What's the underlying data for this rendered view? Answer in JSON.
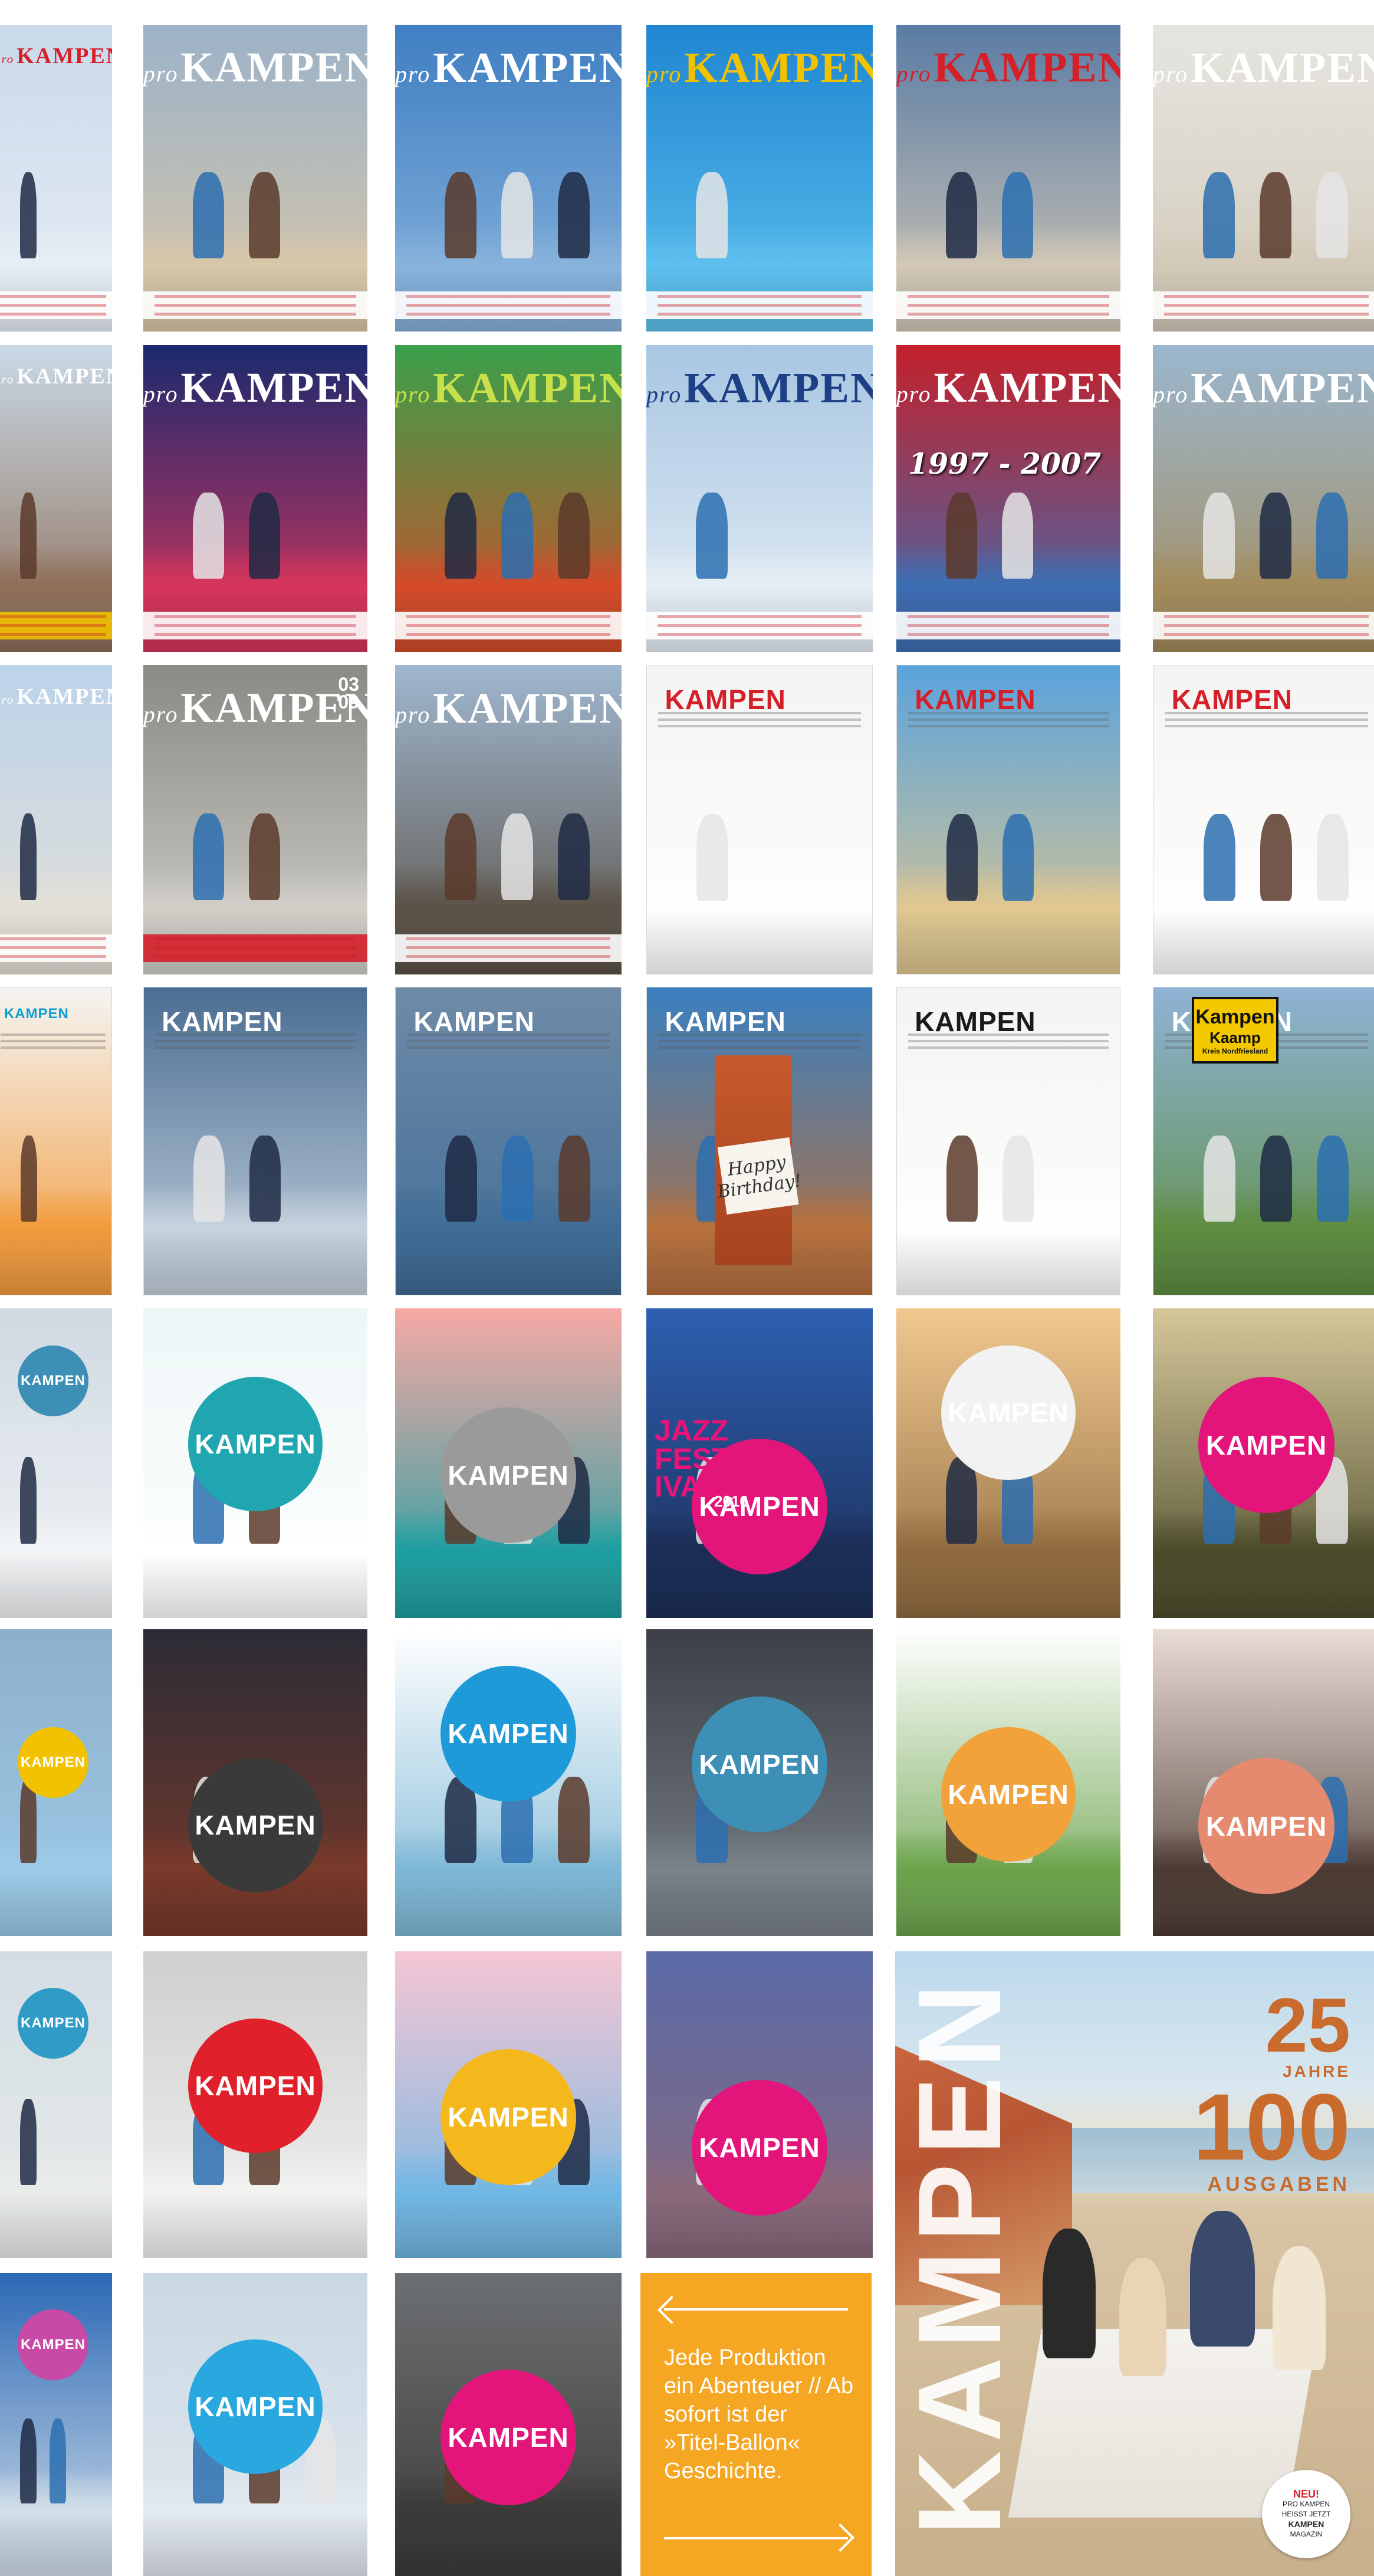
{
  "masthead": "KAMPEN",
  "prefix": "pro",
  "covers": [
    {
      "kind": "serif",
      "bg": [
        "#c9d9ea",
        "#e7eef5"
      ],
      "mast": "#d5202a",
      "band": "#ffffff"
    },
    {
      "kind": "serif",
      "bg": [
        "#9cb2c8",
        "#d8c7a8"
      ],
      "mast": "#ffffff",
      "band": "#ffffff"
    },
    {
      "kind": "serif",
      "bg": [
        "#3f7fc2",
        "#88b3dc"
      ],
      "mast": "#ffffff",
      "band": "#ffffff"
    },
    {
      "kind": "serif",
      "bg": [
        "#1f86d1",
        "#5ec0ee"
      ],
      "mast": "#f2c200",
      "band": "#ffffff"
    },
    {
      "kind": "serif",
      "bg": [
        "#5a7ca4",
        "#d3c8b6"
      ],
      "mast": "#d5202a",
      "band": "#ffffff"
    },
    {
      "kind": "serif",
      "bg": [
        "#e5e5e0",
        "#d3c9b8"
      ],
      "mast": "#ffffff",
      "band": "#ffffff"
    },
    {
      "kind": "serif",
      "bg": [
        "#c9d9e7",
        "#8e6f58"
      ],
      "mast": "#ffffff",
      "band": "#f0c000"
    },
    {
      "kind": "serif",
      "bg": [
        "#1b2a6e",
        "#d9355b"
      ],
      "mast": "#ffffff",
      "band": "#ffffff"
    },
    {
      "kind": "serif",
      "bg": [
        "#3aa04a",
        "#d54a2a"
      ],
      "mast": "#c8e04a",
      "band": "#ffffff"
    },
    {
      "kind": "serif",
      "bg": [
        "#a8c6e2",
        "#e6eef5"
      ],
      "mast": "#1d3f86",
      "band": "#ffffff"
    },
    {
      "kind": "serif",
      "bg": [
        "#c3202a",
        "#3b6fb5"
      ],
      "mast": "#ffffff",
      "band": "#ffffff"
    },
    {
      "kind": "serif",
      "bg": [
        "#9bb7cf",
        "#a48b5a"
      ],
      "mast": "#ffffff",
      "band": "#ffffff"
    },
    {
      "kind": "serif",
      "bg": [
        "#bcd3ea",
        "#e4e0d6"
      ],
      "mast": "#ffffff",
      "band": "#ffffff"
    },
    {
      "kind": "serif",
      "bg": [
        "#8a8a86",
        "#d1cfc8"
      ],
      "mast": "#ffffff",
      "band": "#d5202a"
    },
    {
      "kind": "serif",
      "bg": [
        "#9fb7cf",
        "#5b5146"
      ],
      "mast": "#ffffff",
      "band": "#ffffff"
    },
    {
      "kind": "sans",
      "bg": [
        "#f4f4f2",
        "#ffffff"
      ],
      "mast": "#d5202a",
      "band": "#ffffff"
    },
    {
      "kind": "sans",
      "bg": [
        "#5aa3dc",
        "#e2c88e"
      ],
      "mast": "#d5202a",
      "band": "#ffffff"
    },
    {
      "kind": "sans",
      "bg": [
        "#f4f4f2",
        "#ffffff"
      ],
      "mast": "#d5202a",
      "band": "#ffffff"
    },
    {
      "kind": "sans",
      "bg": [
        "#f4f4f2",
        "#f29a3a"
      ],
      "mast": "#0aa0d0",
      "band": "#ffffff"
    },
    {
      "kind": "sans",
      "bg": [
        "#4a6d92",
        "#c7d3df"
      ],
      "mast": "#ffffff",
      "band": "#ffffff"
    },
    {
      "kind": "sans",
      "bg": [
        "#6f8ba8",
        "#3f6c96"
      ],
      "mast": "#ffffff",
      "band": "#ffffff"
    },
    {
      "kind": "sans",
      "bg": [
        "#3a7fc0",
        "#b9703a"
      ],
      "mast": "#ffffff",
      "band": "#ffffff"
    },
    {
      "kind": "sans",
      "bg": [
        "#f4f4f2",
        "#ffffff"
      ],
      "mast": "#1a1a1a",
      "band": "#ffffff"
    },
    {
      "kind": "sans",
      "bg": [
        "#8fb3d6",
        "#5d8c3e"
      ],
      "mast": "#ffffff",
      "band": "#ffffff"
    },
    {
      "kind": "bubble",
      "bg": [
        "#cfd9e2",
        "#f2f4f6"
      ],
      "bubble": "#3d8fb5"
    },
    {
      "kind": "bubble",
      "bg": [
        "#eef6f7",
        "#ffffff"
      ],
      "bubble": "#20a6b0"
    },
    {
      "kind": "bubble",
      "bg": [
        "#f7a9a5",
        "#1b9fa2"
      ],
      "bubble": "#9a9a9a"
    },
    {
      "kind": "bubble",
      "bg": [
        "#2d5fb0",
        "#1c2d55"
      ],
      "bubble": "#e3157a"
    },
    {
      "kind": "bubble",
      "bg": [
        "#f0c890",
        "#8f6a3e"
      ],
      "bubble": "#f2f2f2"
    },
    {
      "kind": "bubble",
      "bg": [
        "#d5c79a",
        "#4a4a2a"
      ],
      "bubble": "#e3157a"
    },
    {
      "kind": "bubble",
      "bg": [
        "#8fb0cc",
        "#9ccbe8"
      ],
      "bubble": "#f2c200"
    },
    {
      "kind": "bubble",
      "bg": [
        "#2c2c36",
        "#7a3a2a"
      ],
      "bubble": "#3a3a3a"
    },
    {
      "kind": "bubble",
      "bg": [
        "#ffffff",
        "#7cb7d6"
      ],
      "bubble": "#1f9ad8"
    },
    {
      "kind": "bubble",
      "bg": [
        "#3c3f46",
        "#7b828a"
      ],
      "bubble": "#3d8fb5"
    },
    {
      "kind": "bubble",
      "bg": [
        "#ffffff",
        "#6aa34a"
      ],
      "bubble": "#f2a23a"
    },
    {
      "kind": "bubble",
      "bg": [
        "#e9dcd5",
        "#4b3a32"
      ],
      "bubble": "#e58a6e"
    },
    {
      "kind": "bubble",
      "bg": [
        "#d3dde5",
        "#e9ece9"
      ],
      "bubble": "#2f9bc6"
    },
    {
      "kind": "bubble",
      "bg": [
        "#cfcfcd",
        "#f2f2f0"
      ],
      "bubble": "#e0202a"
    },
    {
      "kind": "bubble",
      "bg": [
        "#f5c6d4",
        "#6fb7e4"
      ],
      "bubble": "#f5b81c"
    },
    {
      "kind": "bubble",
      "bg": [
        "#5b6aa8",
        "#8a6a7a"
      ],
      "bubble": "#e3157a"
    },
    {
      "kind": "bubble",
      "bg": [
        "#2b68b5",
        "#d4e0ea"
      ],
      "bubble": "#c64aa6"
    },
    {
      "kind": "bubble",
      "bg": [
        "#c9d8e4",
        "#e2e9ef"
      ],
      "bubble": "#29a8e0"
    },
    {
      "kind": "bubble",
      "bg": [
        "#6c6f72",
        "#3c3a38"
      ],
      "bubble": "#e3157a"
    }
  ],
  "special": {
    "cover_2_years": "1997 - 2007",
    "cover_jazz": "JAZZ FEST IVAL",
    "cover_jazz_year": "2016",
    "cover_birthday": "Happy Birthday!",
    "cover_sign_line1": "Kampen",
    "cover_sign_line2": "Kaamp",
    "cover_sign_line3": "Kreis Nordfriesland",
    "issue_a": "03",
    "issue_b": "09"
  },
  "info": {
    "text": "Jede Produktion ein Abenteuer // Ab sofort ist der »Titel-Ballon« Geschichte.",
    "bg": "#f5a623"
  },
  "feature": {
    "title": "KAMPEN",
    "n25": "25",
    "jahre": "JAHRE",
    "n100": "100",
    "ausgaben": "AUSGABEN",
    "badge_neu": "NEU!",
    "badge_l1": "PRO KAMPEN",
    "badge_l2": "HEISST JETZT",
    "badge_l3": "KAMPEN",
    "badge_l4": "MAGAZIN"
  }
}
